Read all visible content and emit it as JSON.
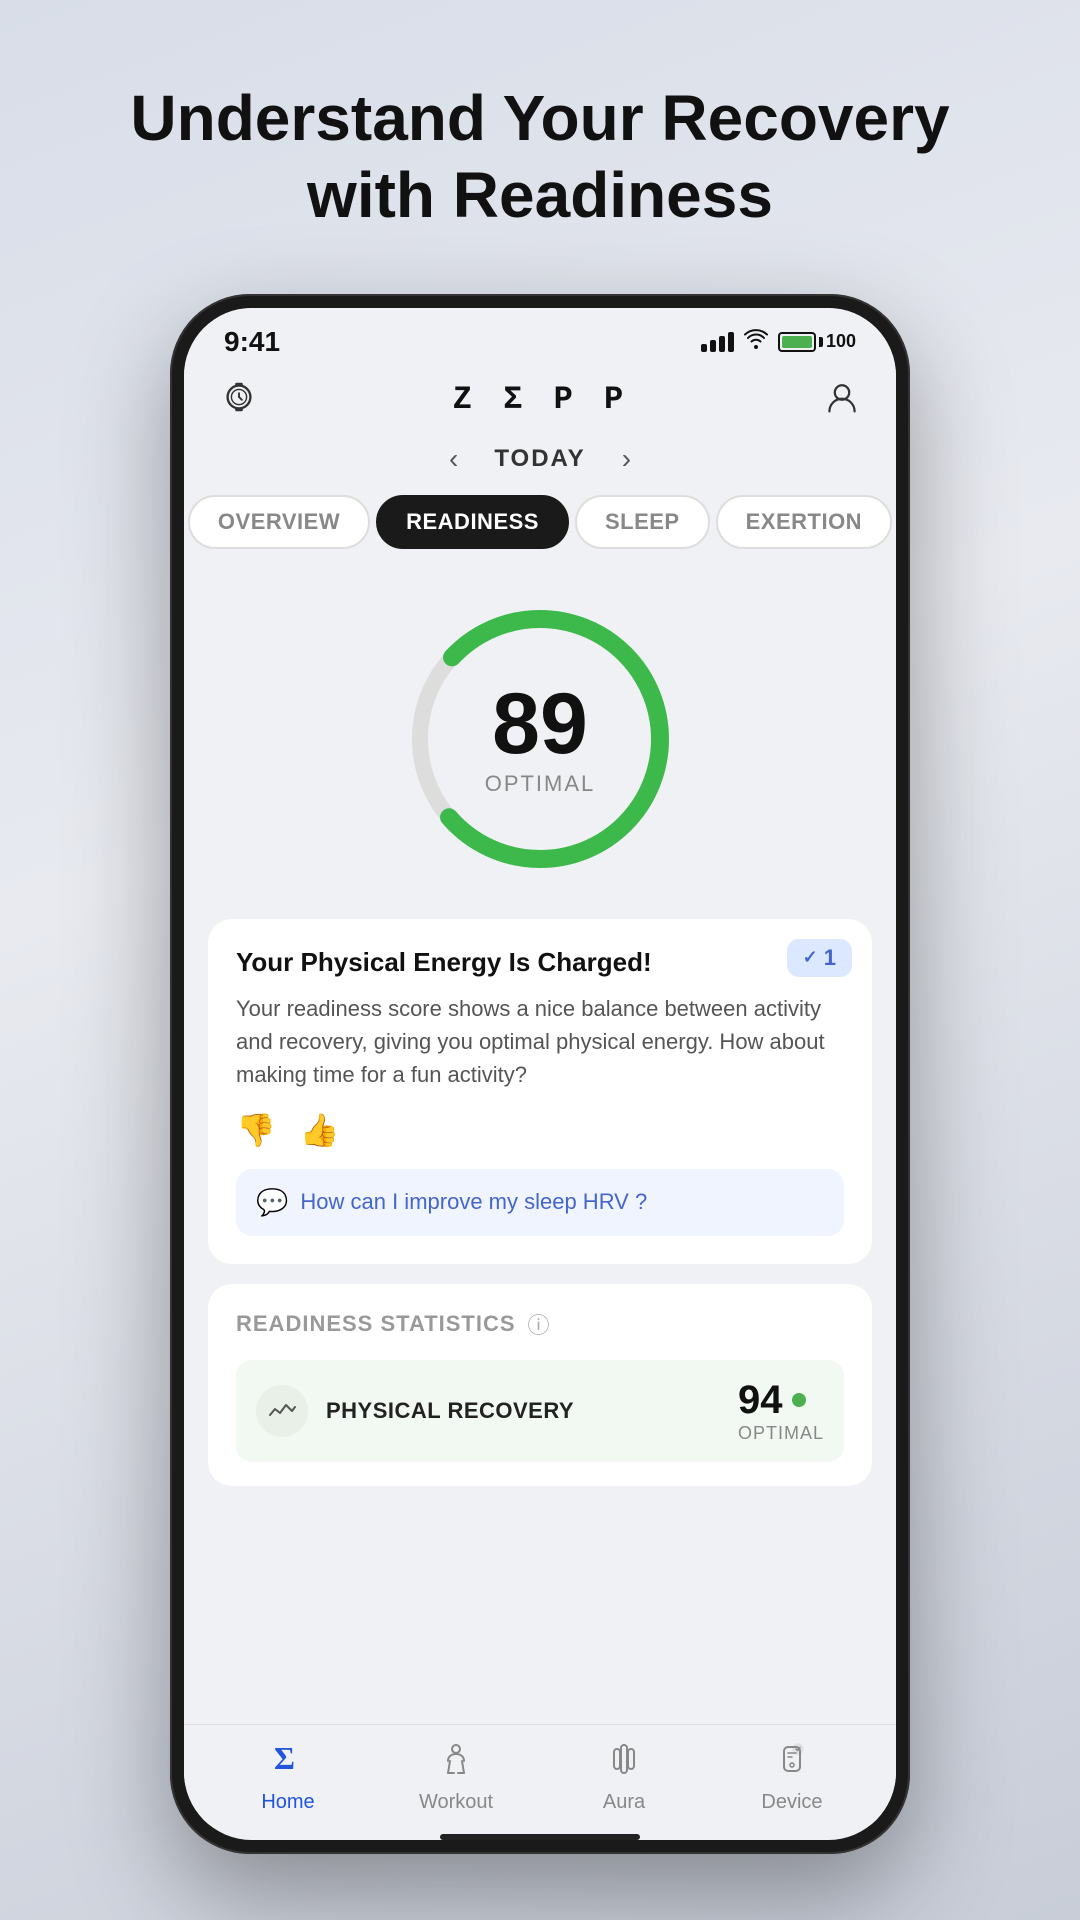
{
  "page": {
    "title_line1": "Understand Your Recovery",
    "title_line2": "with Readiness"
  },
  "status_bar": {
    "time": "9:41",
    "battery_level": "100"
  },
  "header": {
    "logo": "Z Σ P P"
  },
  "date_nav": {
    "label": "TODAY"
  },
  "tabs": [
    {
      "id": "overview",
      "label": "OVERVIEW",
      "active": false
    },
    {
      "id": "readiness",
      "label": "READINESS",
      "active": true
    },
    {
      "id": "sleep",
      "label": "SLEEP",
      "active": false
    },
    {
      "id": "exertion",
      "label": "EXERTION",
      "active": false
    }
  ],
  "score": {
    "value": "89",
    "label": "OPTIMAL",
    "percentage": 89
  },
  "insight_card": {
    "badge_count": "1",
    "title": "Your Physical Energy Is Charged!",
    "text": "Your readiness score shows a nice balance between activity and recovery, giving you optimal physical energy. How about making time for a fun activity?",
    "hrv_question": "How can I improve my sleep HRV ?"
  },
  "stats": {
    "section_title": "READINESS STATISTICS",
    "items": [
      {
        "id": "physical-recovery",
        "name": "PHYSICAL RECOVERY",
        "value": "94",
        "sublabel": "OPTIMAL",
        "dot_color": "#4CAF50"
      }
    ]
  },
  "bottom_nav": [
    {
      "id": "home",
      "label": "Home",
      "active": true
    },
    {
      "id": "workout",
      "label": "Workout",
      "active": false
    },
    {
      "id": "aura",
      "label": "Aura",
      "active": false
    },
    {
      "id": "device",
      "label": "Device",
      "active": false
    }
  ]
}
